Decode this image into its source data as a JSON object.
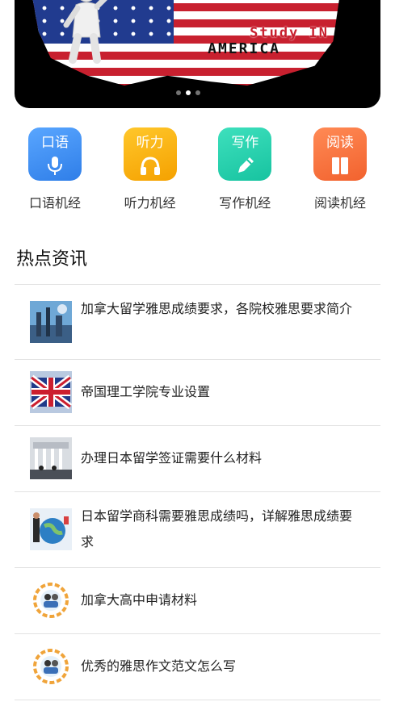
{
  "banner": {
    "line1": "Study IN",
    "line2": "AMERICA"
  },
  "categories": [
    {
      "tile_text": "口语",
      "label": "口语机经",
      "icon": "microphone-icon",
      "color": "#2f7ee8"
    },
    {
      "tile_text": "听力",
      "label": "听力机经",
      "icon": "headphones-icon",
      "color": "#f5a100"
    },
    {
      "tile_text": "写作",
      "label": "写作机经",
      "icon": "pencil-icon",
      "color": "#17c3a0"
    },
    {
      "tile_text": "阅读",
      "label": "阅读机经",
      "icon": "book-icon",
      "color": "#f2622e"
    }
  ],
  "section": {
    "title": "热点资讯"
  },
  "news": [
    {
      "title": "加拿大留学雅思成绩要求，各院校雅思要求简介",
      "thumb": "city-photo"
    },
    {
      "title": "帝国理工学院专业设置",
      "thumb": "union-jack-photo"
    },
    {
      "title": "办理日本留学签证需要什么材料",
      "thumb": "building-photo"
    },
    {
      "title": "日本留学商科需要雅思成绩吗，详解雅思成绩要求",
      "thumb": "globe-students-photo"
    },
    {
      "title": "加拿大高中申请材料",
      "thumb": "students-circle-logo"
    },
    {
      "title": "优秀的雅思作文范文怎么写",
      "thumb": "students-circle-logo"
    }
  ]
}
